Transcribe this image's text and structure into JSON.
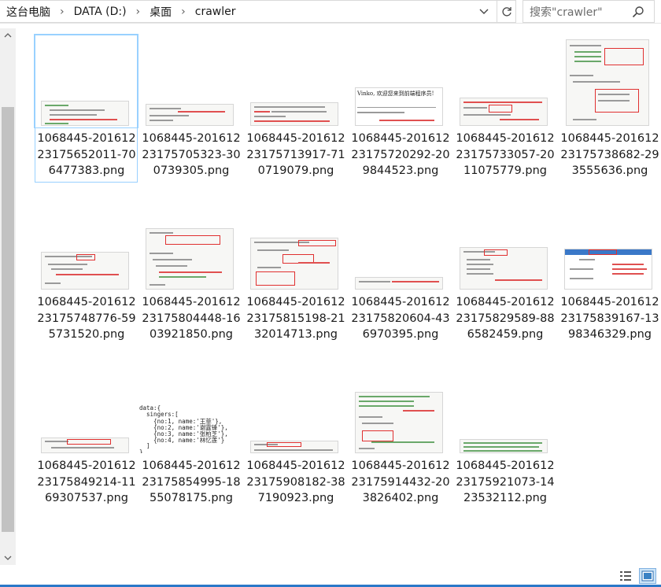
{
  "breadcrumb": [
    "这台电脑",
    "DATA (D:)",
    "桌面",
    "crawler"
  ],
  "search": {
    "placeholder": "搜索\"crawler\""
  },
  "files": [
    {
      "name": "1068445-20161223175652011-706477383.png",
      "selected": true
    },
    {
      "name": "1068445-20161223175705323-300739305.png"
    },
    {
      "name": "1068445-20161223175713917-710719079.png"
    },
    {
      "name": "1068445-20161223175720292-209844523.png"
    },
    {
      "name": "1068445-20161223175733057-2011075779.png"
    },
    {
      "name": "1068445-20161223175738682-293555636.png"
    },
    {
      "name": "1068445-20161223175748776-595731520.png"
    },
    {
      "name": "1068445-20161223175804448-1603921850.png"
    },
    {
      "name": "1068445-20161223175815198-2132014713.png"
    },
    {
      "name": "1068445-20161223175820604-436970395.png"
    },
    {
      "name": "1068445-20161223175829589-886582459.png"
    },
    {
      "name": "1068445-20161223175839167-1398346329.png"
    },
    {
      "name": "1068445-20161223175849214-1169307537.png"
    },
    {
      "name": "1068445-20161223175854995-1855078175.png"
    },
    {
      "name": "1068445-20161223175908182-387190923.png"
    },
    {
      "name": "1068445-20161223175914432-203826402.png"
    },
    {
      "name": "1068445-20161223175921073-1423532112.png"
    }
  ],
  "thumb_text": {
    "t4_title": "Vinko, 欢迎您来到前端程序员!",
    "t14_lines": [
      "data:{",
      "  singers:[",
      "    {no:1, name:'王菲'},",
      "    {no:2, name:'谢霆锋'},",
      "    {no:3, name:'张柏芝'},",
      "    {no:4, name:'林忆莲'}",
      "  ]",
      "}"
    ]
  },
  "colors": {
    "accent": "#2b78c8",
    "selection": "#99d1ff"
  }
}
